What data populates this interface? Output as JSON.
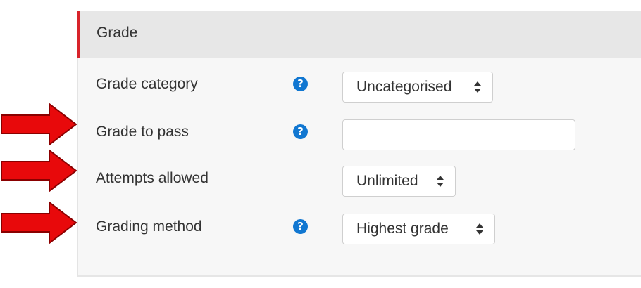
{
  "section": {
    "title": "Grade"
  },
  "fields": {
    "grade_category": {
      "label": "Grade category",
      "value": "Uncategorised",
      "help_icon": "question-circle-icon"
    },
    "grade_to_pass": {
      "label": "Grade to pass",
      "value": "",
      "help_icon": "question-circle-icon"
    },
    "attempts_allowed": {
      "label": "Attempts allowed",
      "value": "Unlimited"
    },
    "grading_method": {
      "label": "Grading method",
      "value": "Highest grade",
      "help_icon": "question-circle-icon"
    }
  },
  "help_icon_glyph": "?",
  "colors": {
    "accent_red": "#d8232a",
    "help_blue": "#1177d1",
    "annotation_arrow": "#e8090b"
  }
}
